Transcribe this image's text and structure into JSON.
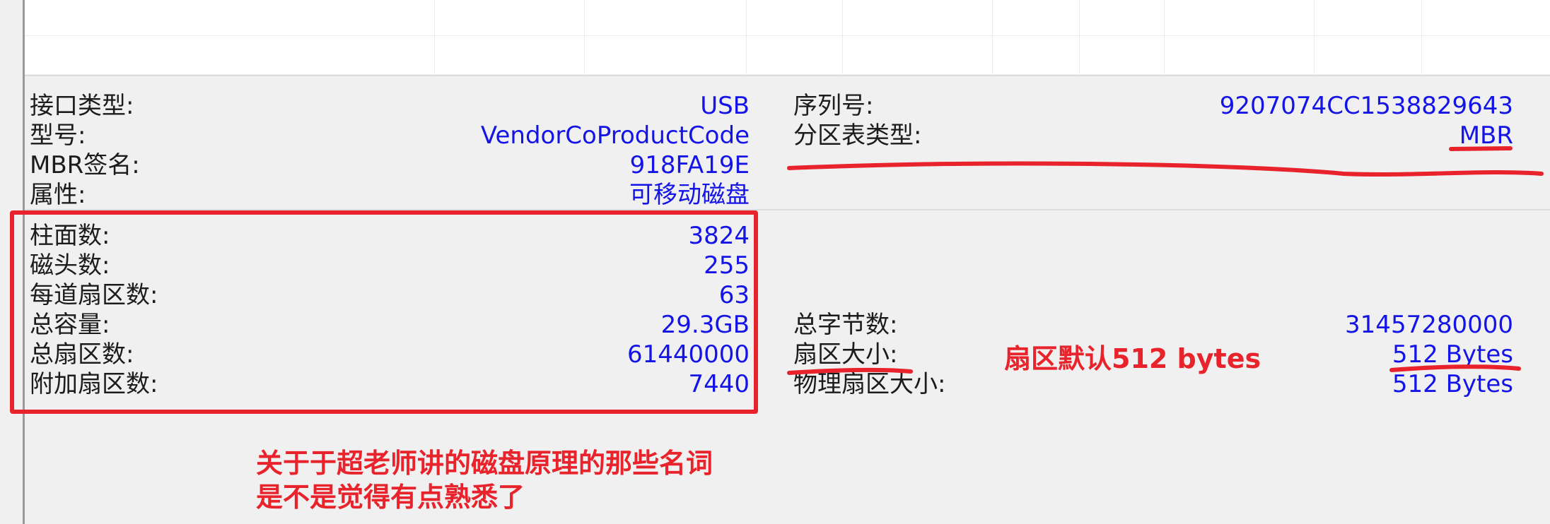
{
  "disk_info": {
    "interface_label": "接口类型:",
    "interface_value": "USB",
    "model_label": "型号:",
    "model_value": "VendorCoProductCode",
    "mbr_sig_label": "MBR签名:",
    "mbr_sig_value": "918FA19E",
    "attr_label": "属性:",
    "attr_value": "可移动磁盘",
    "serial_label": "序列号:",
    "serial_value": "9207074CC1538829643",
    "pt_label": "分区表类型:",
    "pt_value": "MBR"
  },
  "geometry": {
    "cyl_label": "柱面数:",
    "cyl_value": "3824",
    "heads_label": "磁头数:",
    "heads_value": "255",
    "spt_label": "每道扇区数:",
    "spt_value": "63",
    "cap_label": "总容量:",
    "cap_value": "29.3GB",
    "total_sec_label": "总扇区数:",
    "total_sec_value": "61440000",
    "extra_sec_label": "附加扇区数:",
    "extra_sec_value": "7440",
    "total_bytes_label": "总字节数:",
    "total_bytes_value": "31457280000",
    "sector_size_label": "扇区大小:",
    "sector_size_value": "512 Bytes",
    "phys_sector_label": "物理扇区大小:",
    "phys_sector_value": "512 Bytes"
  },
  "annotations": {
    "sector_note": "扇区默认512 bytes",
    "line1": "关于于超老师讲的磁盘原理的那些名词",
    "line2": "是不是觉得有点熟悉了"
  },
  "colors": {
    "label": "#1c1c1c",
    "value": "#1414e6",
    "annotation": "#e8232b"
  }
}
